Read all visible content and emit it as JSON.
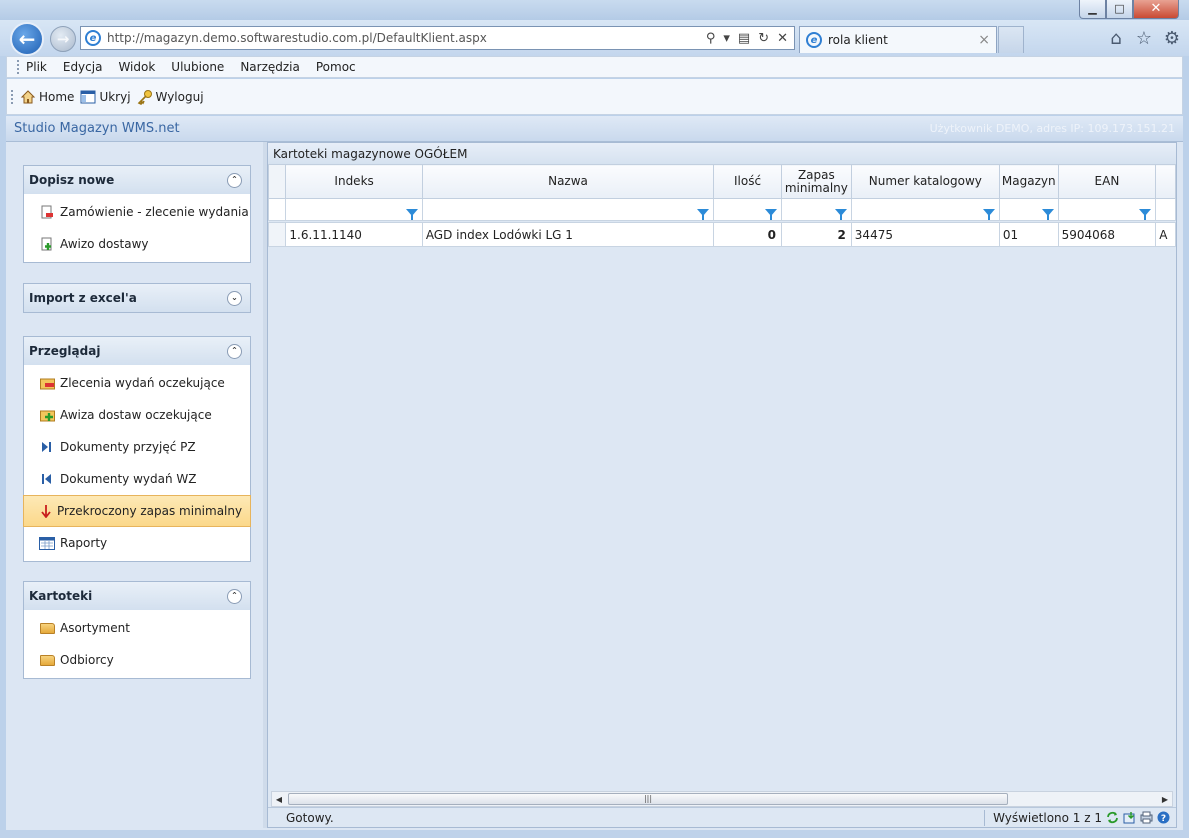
{
  "browser": {
    "url": "http://magazyn.demo.softwarestudio.com.pl/DefaultKlient.aspx",
    "tab_title": "rola klient",
    "tab_close": "×",
    "window_buttons": {
      "minimize": "▁",
      "maximize": "□",
      "close": "✕"
    }
  },
  "menubar": {
    "items": [
      "Plik",
      "Edycja",
      "Widok",
      "Ulubione",
      "Narzędzia",
      "Pomoc"
    ]
  },
  "toolbar": {
    "home_label": "Home",
    "hide_label": "Ukryj",
    "logout_label": "Wyloguj"
  },
  "app": {
    "title": "Studio Magazyn WMS.net",
    "user_info": "Użytkownik DEMO, adres IP: 109.173.151.21"
  },
  "sidebar": {
    "panels": [
      {
        "title": "Dopisz nowe",
        "collapse": "⌃",
        "items": [
          {
            "label": "Zamówienie - zlecenie wydania",
            "icon": "order-document-icon"
          },
          {
            "label": "Awizo dostawy",
            "icon": "add-delivery-icon"
          }
        ]
      },
      {
        "title": "Import z excel'a",
        "collapse": "⌄",
        "items": []
      },
      {
        "title": "Przeglądaj",
        "collapse": "⌃",
        "items": [
          {
            "label": "Zlecenia wydań oczekujące",
            "icon": "pending-orders-icon"
          },
          {
            "label": "Awiza dostaw oczekujące",
            "icon": "pending-deliveries-icon"
          },
          {
            "label": "Dokumenty przyjęć PZ",
            "icon": "receipt-documents-icon"
          },
          {
            "label": "Dokumenty wydań WZ",
            "icon": "issue-documents-icon"
          },
          {
            "label": "Przekroczony zapas minimalny",
            "icon": "arrow-down-icon",
            "active": true
          },
          {
            "label": "Raporty",
            "icon": "reports-icon"
          }
        ]
      },
      {
        "title": "Kartoteki",
        "collapse": "⌃",
        "items": [
          {
            "label": "Asortyment",
            "icon": "folder-icon"
          },
          {
            "label": "Odbiorcy",
            "icon": "folder-icon"
          }
        ]
      }
    ]
  },
  "grid": {
    "title": "Kartoteki magazynowe OGÓŁEM",
    "columns": [
      "Indeks",
      "Nazwa",
      "Ilość",
      "Zapas minimalny",
      "Numer katalogowy",
      "Magazyn",
      "EAN",
      ""
    ],
    "rows": [
      [
        "1.6.11.1140",
        "AGD index Lodówki LG 1",
        "0",
        "2",
        "34475",
        "01",
        "5904068",
        "A"
      ]
    ],
    "scroll_grip": "|||"
  },
  "status": {
    "text": "Gotowy.",
    "count": "Wyświetlono 1 z 1"
  }
}
